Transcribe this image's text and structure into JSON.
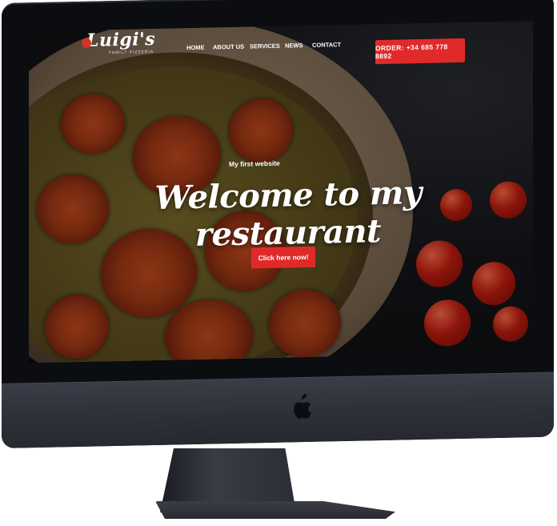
{
  "logo": {
    "name": "Luigi's",
    "subtitle": "FAMILY PIZZERIA"
  },
  "nav": {
    "items": [
      {
        "label": "HOME"
      },
      {
        "label": "ABOUT US"
      },
      {
        "label": "SERVICES"
      },
      {
        "label": "NEWS"
      },
      {
        "label": "CONTACT"
      }
    ],
    "order_button": "ORDER: +34 685 778 8892"
  },
  "hero": {
    "subtitle": "My first website",
    "title": "Welcome to my restaurant",
    "cta": "Click here now!"
  },
  "colors": {
    "accent": "#e02a2a",
    "device": "#0c0d10",
    "chin": "#2e3038"
  },
  "icons": {
    "device_logo": "apple-icon"
  }
}
